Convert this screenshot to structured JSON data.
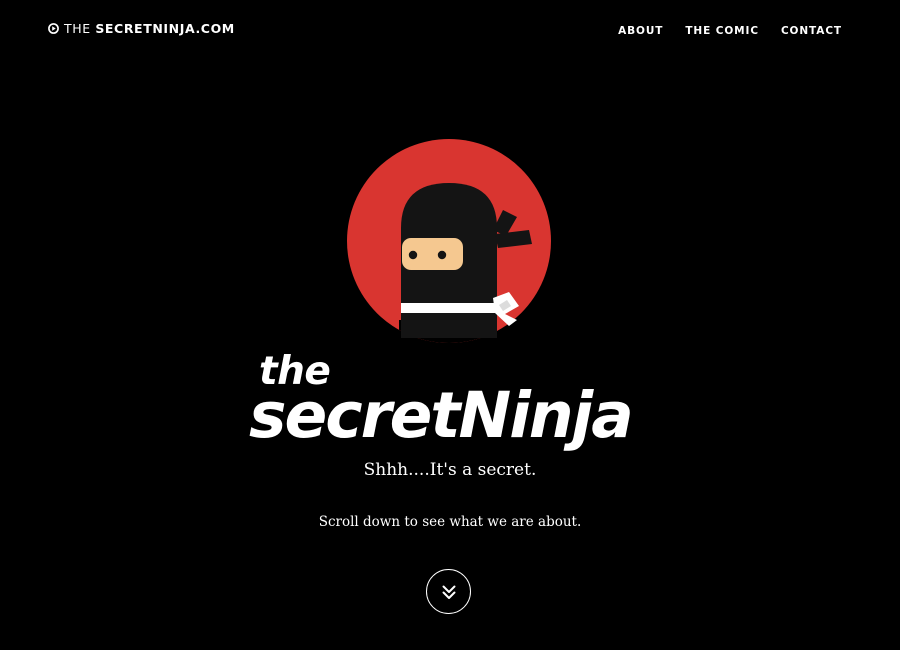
{
  "header": {
    "brand_prefix": "THE ",
    "brand_name": "SECRETNINJA.COM",
    "brand_icon": "play-circle-icon"
  },
  "nav": {
    "items": [
      {
        "label": "ABOUT"
      },
      {
        "label": "THE COMIC"
      },
      {
        "label": "CONTACT"
      }
    ]
  },
  "hero": {
    "logo_word_small": "the",
    "logo_word_large": "secretNinja",
    "tagline": "Shhh....It's a secret.",
    "scroll_text": "Scroll down to see what we are about.",
    "scroll_icon": "double-chevron-down-icon"
  },
  "colors": {
    "background": "#000000",
    "text": "#ffffff",
    "logo_circle": "#d93530",
    "ninja_body": "#141414",
    "ninja_face": "#f5c890",
    "ninja_belt": "#ffffff"
  }
}
